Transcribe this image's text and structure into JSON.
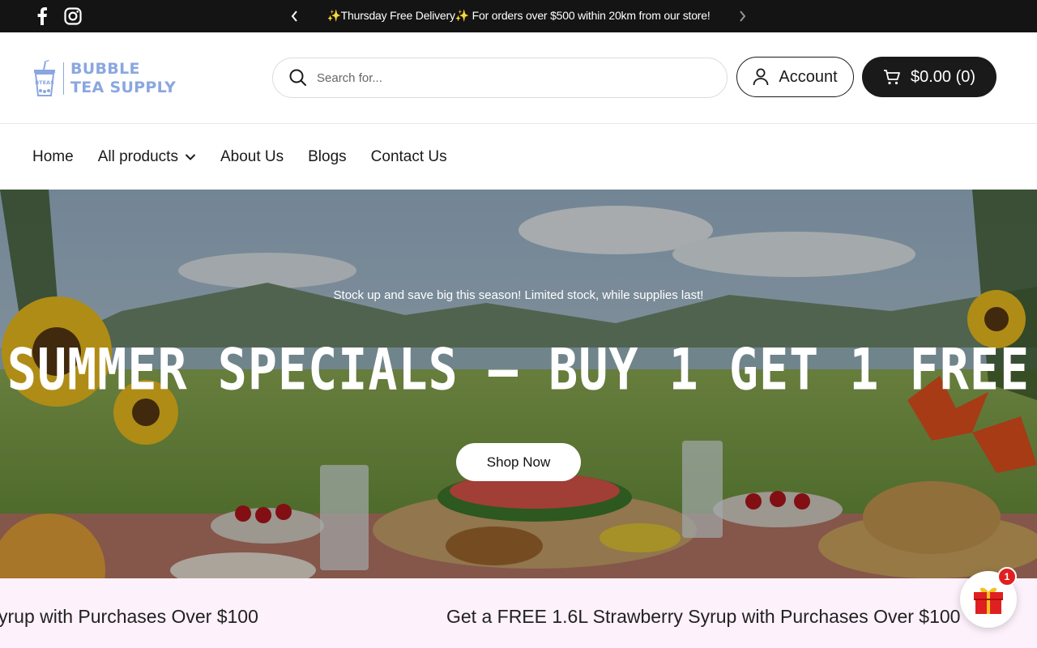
{
  "announcement": {
    "text": "✨Thursday Free Delivery✨ For orders over $500 within 20km from our store!"
  },
  "social": {
    "icons": [
      "facebook-icon",
      "instagram-icon"
    ]
  },
  "header": {
    "logo_line1": "BUBBLE",
    "logo_line2": "TEA SUPPLY",
    "logo_mark": "BTEAS",
    "search_placeholder": "Search for...",
    "account_label": "Account",
    "cart_label": "$0.00 (0)"
  },
  "nav": {
    "items": [
      {
        "label": "Home"
      },
      {
        "label": "All products"
      },
      {
        "label": "About Us"
      },
      {
        "label": "Blogs"
      },
      {
        "label": "Contact Us"
      }
    ]
  },
  "hero": {
    "subtitle": "Stock up and save big this season! Limited stock, while supplies last!",
    "title": "SUMMER SPECIALS – BUY 1 GET 1 FREE",
    "button": "Shop Now"
  },
  "marquee": {
    "text_partial": "yrup with Purchases Over $100",
    "text": "Get a FREE 1.6L Strawberry Syrup with Purchases Over $100"
  },
  "gift": {
    "badge_count": "1"
  },
  "colors": {
    "topbar": "#141414",
    "logo": "#8aa7df",
    "marquee_bg": "#fdf1fb",
    "badge": "#e02020"
  }
}
